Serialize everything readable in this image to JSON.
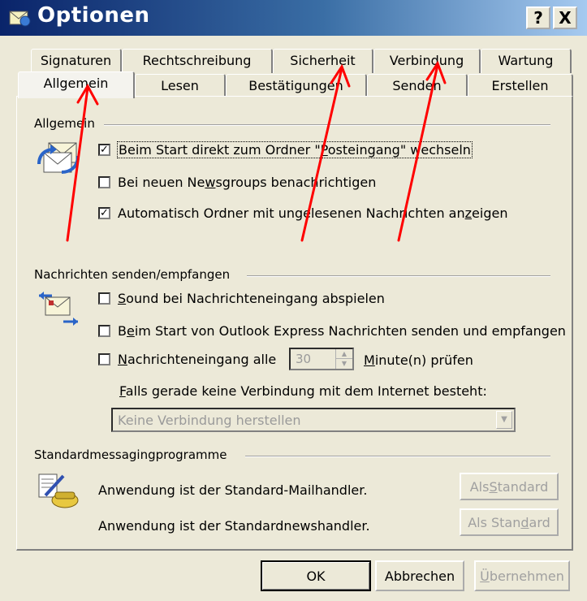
{
  "window": {
    "title": "Optionen",
    "help_button": "?",
    "close_button": "X"
  },
  "tabs": {
    "back_row": [
      "Signaturen",
      "Rechtschreibung",
      "Sicherheit",
      "Verbindung",
      "Wartung"
    ],
    "front_row": [
      "Allgemein",
      "Lesen",
      "Bestätigungen",
      "Senden",
      "Erstellen"
    ],
    "active": "Allgemein"
  },
  "sections": {
    "allgemein": {
      "title": "Allgemein",
      "icon": "mail-envelopes-icon",
      "options": [
        {
          "pre": "Beim Start direkt zum Ordner \"",
          "u": "P",
          "post": "osteingang\" wechseln",
          "checked": true
        },
        {
          "pre": "Bei neuen Ne",
          "u": "w",
          "post": "sgroups benachrichtigen",
          "checked": false
        },
        {
          "pre": "Automatisch Ordner mit ungelesenen Nachrichten an",
          "u": "z",
          "post": "eigen",
          "checked": true
        }
      ]
    },
    "senden": {
      "title": "Nachrichten senden/empfangen",
      "icon": "send-receive-icon",
      "sound": {
        "pre": "",
        "u": "S",
        "post": "ound bei Nachrichteneingang abspielen",
        "checked": false
      },
      "start": {
        "pre": "B",
        "u": "e",
        "post": "im Start von Outlook Express Nachrichten senden und empfangen",
        "checked": false
      },
      "interval": {
        "pre": "",
        "u": "N",
        "post": "achrichteneingang alle",
        "checked": false,
        "value": "30",
        "unit_pre": "",
        "unit_u": "M",
        "unit_post": "inute(n) prüfen"
      },
      "no_connection_label": {
        "pre": "",
        "u": "F",
        "post": "alls gerade keine Verbindung mit dem Internet besteht:"
      },
      "no_connection_value": "Keine Verbindung herstellen"
    },
    "standard": {
      "title": "Standardmessagingprogramme",
      "icon": "phone-pen-icon",
      "mail_text": "Anwendung ist der Standard-Mailhandler.",
      "news_text": "Anwendung ist der Standardnewshandler.",
      "mail_button": {
        "pre": "Als ",
        "u": "S",
        "post": "tandard"
      },
      "news_button": {
        "pre": "Als Stan",
        "u": "d",
        "post": "ard"
      }
    }
  },
  "footer": {
    "ok": "OK",
    "cancel": "Abbrechen",
    "apply": {
      "pre": "",
      "u": "Ü",
      "post": "bernehmen"
    }
  },
  "colors": {
    "title_gradient_start": "#0A246A",
    "title_gradient_end": "#A6CAF0",
    "dialog_bg": "#ECE9D8",
    "annotation_arrow": "#FF0000"
  }
}
